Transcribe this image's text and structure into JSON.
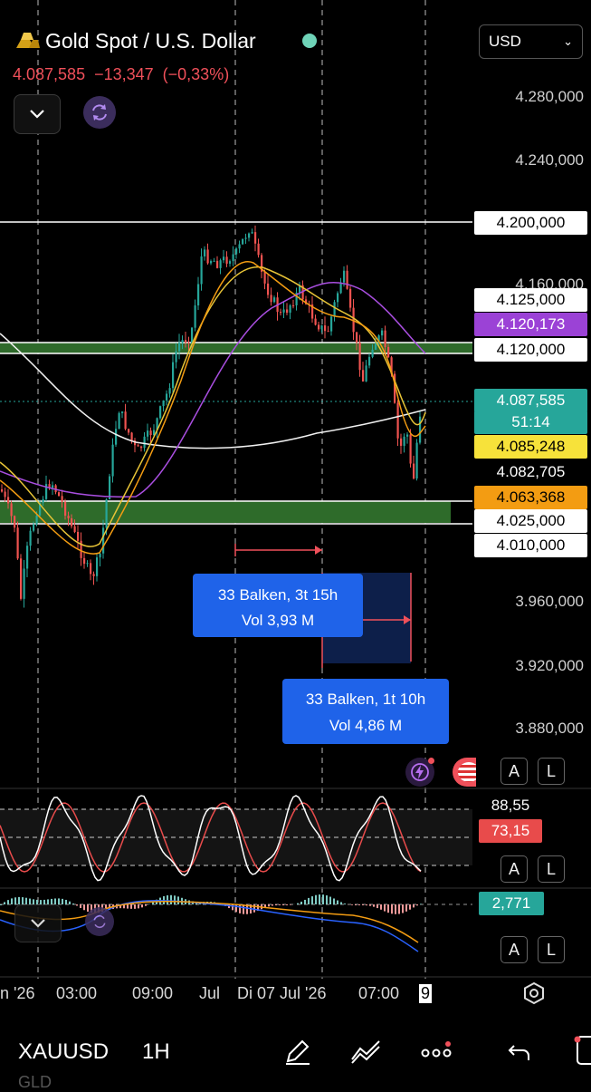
{
  "header": {
    "symbol_title": "Gold Spot / U.S. Dollar",
    "last_price": "4.087,585",
    "change": "−13,347",
    "change_pct": "(−0,33%)",
    "currency": "USD",
    "colors": {
      "down": "#f0505a",
      "live": "#6fd3b8",
      "accent": "#1f63e9"
    }
  },
  "price_axis": {
    "labels": [
      "4.280,000",
      "4.240,000",
      "4.160,000",
      "3.960,000",
      "3.920,000",
      "3.880,000"
    ]
  },
  "price_tags": [
    {
      "text": "4.200,000",
      "style": "white"
    },
    {
      "text": "4.125,000",
      "style": "white"
    },
    {
      "text": "4.120,173",
      "style": "purple"
    },
    {
      "text": "4.120,000",
      "style": "white"
    },
    {
      "text": "4.087,585",
      "style": "green"
    },
    {
      "text": "51:14",
      "style": "green"
    },
    {
      "text": "4.085,248",
      "style": "yellow"
    },
    {
      "text": "4.082,705",
      "style": "plain"
    },
    {
      "text": "4.063,368",
      "style": "orange"
    },
    {
      "text": "4.025,000",
      "style": "white"
    },
    {
      "text": "4.010,000",
      "style": "white"
    }
  ],
  "measurements": [
    {
      "bars": "33 Balken, 3t 15h",
      "vol": "Vol 3,93 M"
    },
    {
      "bars": "33 Balken, 1t 10h",
      "vol": "Vol 4,86 M"
    }
  ],
  "stoch": {
    "k": "88,55",
    "d": "73,15"
  },
  "macd": {
    "value": "2,771"
  },
  "scale_buttons": {
    "auto": "A",
    "log": "L"
  },
  "time_axis": {
    "labels": [
      "n '26",
      "03:00",
      "09:00",
      "Jul",
      "Di 07 Jul '26",
      "07:00",
      "9"
    ]
  },
  "toolbar": {
    "ticker": "XAUUSD",
    "interval": "1H",
    "subtitle": "GLD"
  }
}
